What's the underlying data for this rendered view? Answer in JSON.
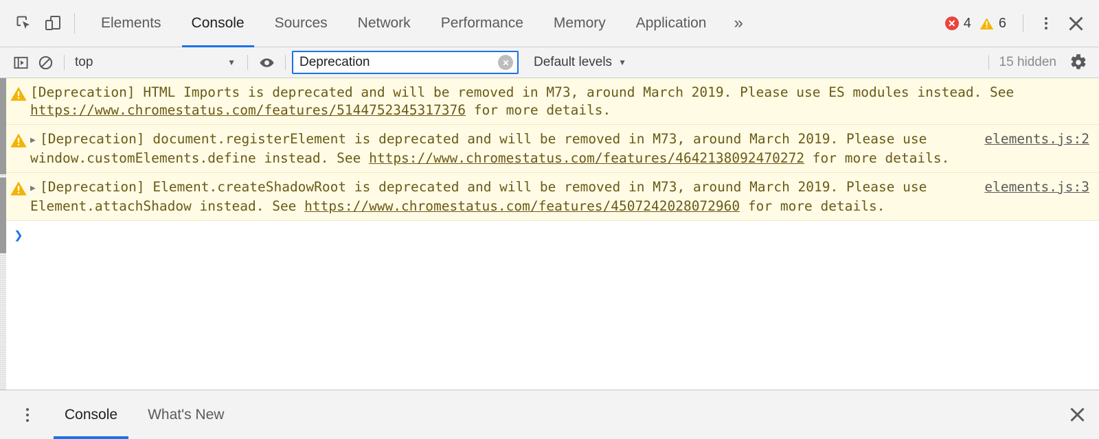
{
  "toolbar": {
    "inspect_icon": "inspect-element-icon",
    "device_icon": "device-toolbar-icon",
    "tabs": [
      {
        "label": "Elements",
        "active": false
      },
      {
        "label": "Console",
        "active": true
      },
      {
        "label": "Sources",
        "active": false
      },
      {
        "label": "Network",
        "active": false
      },
      {
        "label": "Performance",
        "active": false
      },
      {
        "label": "Memory",
        "active": false
      },
      {
        "label": "Application",
        "active": false
      }
    ],
    "more_tabs_label": "»",
    "error_count": "4",
    "warning_count": "6",
    "error_color": "#e8453c",
    "warning_color": "#f5b400",
    "accent_color": "#1a73e8",
    "menu_icon": "kebab-menu-icon",
    "close_icon": "close-icon"
  },
  "filter_bar": {
    "sidebar_toggle_icon": "console-sidebar-icon",
    "clear_console_icon": "clear-console-icon",
    "context": {
      "value": "top",
      "caret": "▼"
    },
    "live_expression_icon": "eye-icon",
    "filter": {
      "value": "Deprecation",
      "placeholder": "Filter",
      "clear_icon": "clear-input-icon",
      "focused": true,
      "focus_color": "#1a73e8"
    },
    "levels": {
      "label": "Default levels",
      "caret": "▼"
    },
    "hidden_text": "15 hidden",
    "settings_icon": "gear-icon"
  },
  "console": {
    "messages": [
      {
        "level": "warning",
        "icon": "warning-triangle-icon",
        "expandable": false,
        "source": "",
        "parts": [
          {
            "type": "text",
            "value": "[Deprecation] HTML Imports is deprecated and will be removed in M73, around March 2019. Please use ES modules instead. See "
          },
          {
            "type": "link",
            "value": "https://www.chromestatus.com/features/5144752345317376"
          },
          {
            "type": "text",
            "value": " for more details."
          }
        ]
      },
      {
        "level": "warning",
        "icon": "warning-triangle-icon",
        "expandable": true,
        "disclosure_icon": "chevron-right-icon",
        "source": "elements.js:2",
        "parts": [
          {
            "type": "text",
            "value": "[Deprecation] document.registerElement is deprecated and will be removed in M73, around March 2019. Please use window.customElements.define instead. See "
          },
          {
            "type": "link",
            "value": "https://www.chromestatus.com/features/4642138092470272"
          },
          {
            "type": "text",
            "value": " for more details."
          }
        ]
      },
      {
        "level": "warning",
        "icon": "warning-triangle-icon",
        "expandable": true,
        "disclosure_icon": "chevron-right-icon",
        "source": "elements.js:3",
        "parts": [
          {
            "type": "text",
            "value": "[Deprecation] Element.createShadowRoot is deprecated and will be removed in M73, around March 2019. Please use Element.attachShadow instead. See "
          },
          {
            "type": "link",
            "value": "https://www.chromestatus.com/features/4507242028072960"
          },
          {
            "type": "text",
            "value": " for more details."
          }
        ]
      }
    ],
    "prompt": {
      "marker": "❯",
      "value": "",
      "marker_color": "#1a73e8"
    },
    "message_bg": "#fffbe5",
    "message_text_color": "#6b5a16"
  },
  "drawer": {
    "menu_icon": "kebab-menu-icon",
    "tabs": [
      {
        "label": "Console",
        "active": true
      },
      {
        "label": "What's New",
        "active": false
      }
    ],
    "close_icon": "close-icon"
  }
}
